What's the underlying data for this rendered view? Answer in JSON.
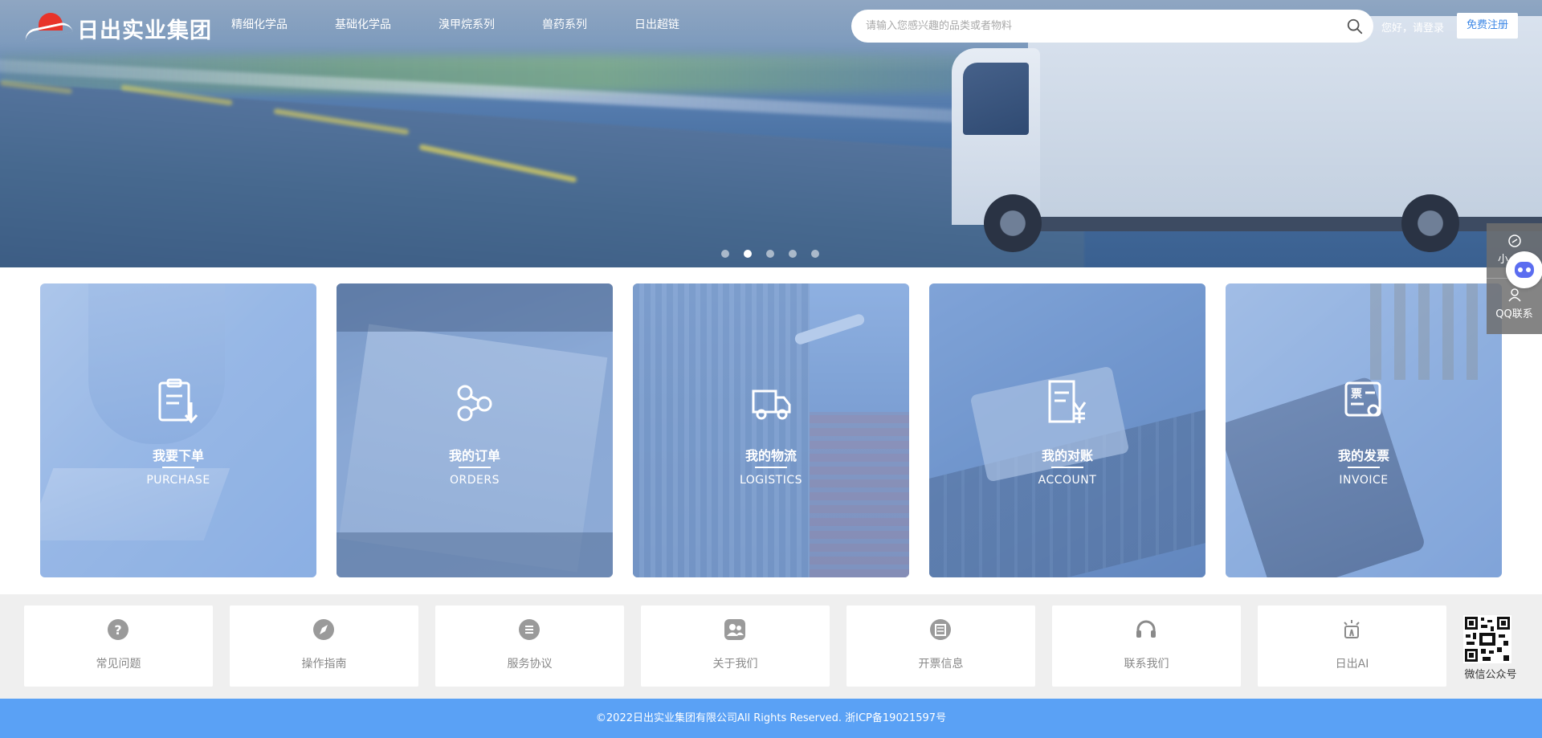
{
  "brand": {
    "name": "日出实业集团"
  },
  "nav": {
    "items": [
      {
        "label": "精细化学品"
      },
      {
        "label": "基础化学品"
      },
      {
        "label": "溴甲烷系列"
      },
      {
        "label": "兽药系列"
      },
      {
        "label": "日出超链"
      }
    ]
  },
  "search": {
    "placeholder": "请输入您感兴趣的品类或者物料",
    "value": ""
  },
  "user": {
    "greeting": "您好，请登录",
    "register_label": "免费注册"
  },
  "carousel": {
    "slide_count": 5,
    "active_index": 1
  },
  "services": [
    {
      "title": "我要下单",
      "subtitle": "PURCHASE",
      "icon": "purchase-clipboard-icon"
    },
    {
      "title": "我的订单",
      "subtitle": "ORDERS",
      "icon": "share-nodes-icon"
    },
    {
      "title": "我的物流",
      "subtitle": "LOGISTICS",
      "icon": "truck-icon"
    },
    {
      "title": "我的对账",
      "subtitle": "ACCOUNT",
      "icon": "yuan-document-icon"
    },
    {
      "title": "我的发票",
      "subtitle": "INVOICE",
      "icon": "invoice-ticket-icon"
    }
  ],
  "quick_links": [
    {
      "label": "常见问题",
      "icon": "question-icon"
    },
    {
      "label": "操作指南",
      "icon": "compass-icon"
    },
    {
      "label": "服务协议",
      "icon": "list-icon"
    },
    {
      "label": "关于我们",
      "icon": "users-icon"
    },
    {
      "label": "开票信息",
      "icon": "receipt-icon"
    },
    {
      "label": "联系我们",
      "icon": "headset-icon"
    },
    {
      "label": "日出AI",
      "icon": "ai-lightbulb-icon"
    }
  ],
  "wechat": {
    "label": "微信公众号"
  },
  "float_panel": {
    "mini_label": "小",
    "qq_label": "QQ联系"
  },
  "footer": {
    "copyright": "©2022日出实业集团有限公司All Rights Reserved. 浙ICP备19021597号"
  },
  "colors": {
    "accent": "#5aa1f5",
    "register_text": "#3c87e6",
    "logo_red": "#e8332a",
    "link_gray": "#888888",
    "links_bg": "#efefef"
  }
}
